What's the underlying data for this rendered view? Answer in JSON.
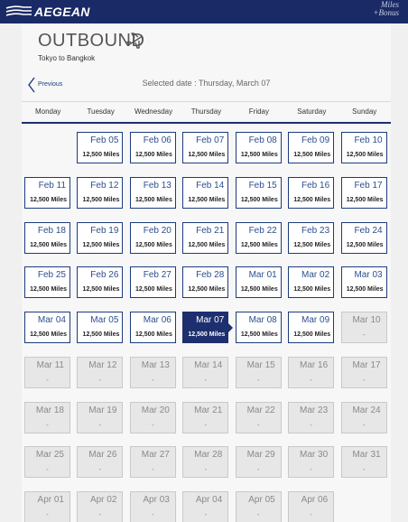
{
  "header": {
    "brand": "AEGEAN",
    "miles_logo_line1": "Miles",
    "miles_logo_line2": "+Bonus"
  },
  "title": "OUTBOUND",
  "route": "Tokyo to Bangkok",
  "previous_label": "Previous",
  "selected_date_text": "Selected date : Thursday, March 07",
  "weekdays": [
    "Monday",
    "Tuesday",
    "Wednesday",
    "Thursday",
    "Friday",
    "Saturday",
    "Sunday"
  ],
  "days": [
    {
      "date": "Feb 05",
      "miles": "12,500 Miles",
      "state": "available"
    },
    {
      "date": "Feb 06",
      "miles": "12,500 Miles",
      "state": "available"
    },
    {
      "date": "Feb 07",
      "miles": "12,500 Miles",
      "state": "available"
    },
    {
      "date": "Feb 08",
      "miles": "12,500 Miles",
      "state": "available"
    },
    {
      "date": "Feb 09",
      "miles": "12,500 Miles",
      "state": "available"
    },
    {
      "date": "Feb 10",
      "miles": "12,500 Miles",
      "state": "available"
    },
    {
      "date": "Feb 11",
      "miles": "12,500 Miles",
      "state": "available"
    },
    {
      "date": "Feb 12",
      "miles": "12,500 Miles",
      "state": "available"
    },
    {
      "date": "Feb 13",
      "miles": "12,500 Miles",
      "state": "available"
    },
    {
      "date": "Feb 14",
      "miles": "12,500 Miles",
      "state": "available"
    },
    {
      "date": "Feb 15",
      "miles": "12,500 Miles",
      "state": "available"
    },
    {
      "date": "Feb 16",
      "miles": "12,500 Miles",
      "state": "available"
    },
    {
      "date": "Feb 17",
      "miles": "12,500 Miles",
      "state": "available"
    },
    {
      "date": "Feb 18",
      "miles": "12,500 Miles",
      "state": "available"
    },
    {
      "date": "Feb 19",
      "miles": "12,500 Miles",
      "state": "available"
    },
    {
      "date": "Feb 20",
      "miles": "12,500 Miles",
      "state": "available"
    },
    {
      "date": "Feb 21",
      "miles": "12,500 Miles",
      "state": "available"
    },
    {
      "date": "Feb 22",
      "miles": "12,500 Miles",
      "state": "available"
    },
    {
      "date": "Feb 23",
      "miles": "12,500 Miles",
      "state": "available"
    },
    {
      "date": "Feb 24",
      "miles": "12,500 Miles",
      "state": "available"
    },
    {
      "date": "Feb 25",
      "miles": "12,500 Miles",
      "state": "available"
    },
    {
      "date": "Feb 26",
      "miles": "12,500 Miles",
      "state": "available"
    },
    {
      "date": "Feb 27",
      "miles": "12,500 Miles",
      "state": "available"
    },
    {
      "date": "Feb 28",
      "miles": "12,500 Miles",
      "state": "available"
    },
    {
      "date": "Mar 01",
      "miles": "12,500 Miles",
      "state": "available"
    },
    {
      "date": "Mar 02",
      "miles": "12,500 Miles",
      "state": "available"
    },
    {
      "date": "Mar 03",
      "miles": "12,500 Miles",
      "state": "available"
    },
    {
      "date": "Mar 04",
      "miles": "12,500 Miles",
      "state": "available"
    },
    {
      "date": "Mar 05",
      "miles": "12,500 Miles",
      "state": "available"
    },
    {
      "date": "Mar 06",
      "miles": "12,500 Miles",
      "state": "available"
    },
    {
      "date": "Mar 07",
      "miles": "12,500 Miles",
      "state": "selected"
    },
    {
      "date": "Mar 08",
      "miles": "12,500 Miles",
      "state": "available"
    },
    {
      "date": "Mar 09",
      "miles": "12,500 Miles",
      "state": "available"
    },
    {
      "date": "Mar 10",
      "miles": "-",
      "state": "unavailable"
    },
    {
      "date": "Mar 11",
      "miles": "-",
      "state": "unavailable"
    },
    {
      "date": "Mar 12",
      "miles": "-",
      "state": "unavailable"
    },
    {
      "date": "Mar 13",
      "miles": "-",
      "state": "unavailable"
    },
    {
      "date": "Mar 14",
      "miles": "-",
      "state": "unavailable"
    },
    {
      "date": "Mar 15",
      "miles": "-",
      "state": "unavailable"
    },
    {
      "date": "Mar 16",
      "miles": "-",
      "state": "unavailable"
    },
    {
      "date": "Mar 17",
      "miles": "-",
      "state": "unavailable"
    },
    {
      "date": "Mar 18",
      "miles": "-",
      "state": "unavailable"
    },
    {
      "date": "Mar 19",
      "miles": "-",
      "state": "unavailable"
    },
    {
      "date": "Mar 20",
      "miles": "-",
      "state": "unavailable"
    },
    {
      "date": "Mar 21",
      "miles": "-",
      "state": "unavailable"
    },
    {
      "date": "Mar 22",
      "miles": "-",
      "state": "unavailable"
    },
    {
      "date": "Mar 23",
      "miles": "-",
      "state": "unavailable"
    },
    {
      "date": "Mar 24",
      "miles": "-",
      "state": "unavailable"
    },
    {
      "date": "Mar 25",
      "miles": "-",
      "state": "unavailable"
    },
    {
      "date": "Mar 26",
      "miles": "-",
      "state": "unavailable"
    },
    {
      "date": "Mar 27",
      "miles": "-",
      "state": "unavailable"
    },
    {
      "date": "Mar 28",
      "miles": "-",
      "state": "unavailable"
    },
    {
      "date": "Mar 29",
      "miles": "-",
      "state": "unavailable"
    },
    {
      "date": "Mar 30",
      "miles": "-",
      "state": "unavailable"
    },
    {
      "date": "Mar 31",
      "miles": "-",
      "state": "unavailable"
    },
    {
      "date": "Apr 01",
      "miles": "-",
      "state": "unavailable"
    },
    {
      "date": "Apr 02",
      "miles": "-",
      "state": "unavailable"
    },
    {
      "date": "Apr 03",
      "miles": "-",
      "state": "unavailable"
    },
    {
      "date": "Apr 04",
      "miles": "-",
      "state": "unavailable"
    },
    {
      "date": "Apr 05",
      "miles": "-",
      "state": "unavailable"
    },
    {
      "date": "Apr 06",
      "miles": "-",
      "state": "unavailable"
    }
  ],
  "colors": {
    "brand_navy": "#1a2a66",
    "selected": "#1d2f6e",
    "cell_border": "#1d3c7c",
    "unavailable_bg": "#e7e7e7"
  }
}
